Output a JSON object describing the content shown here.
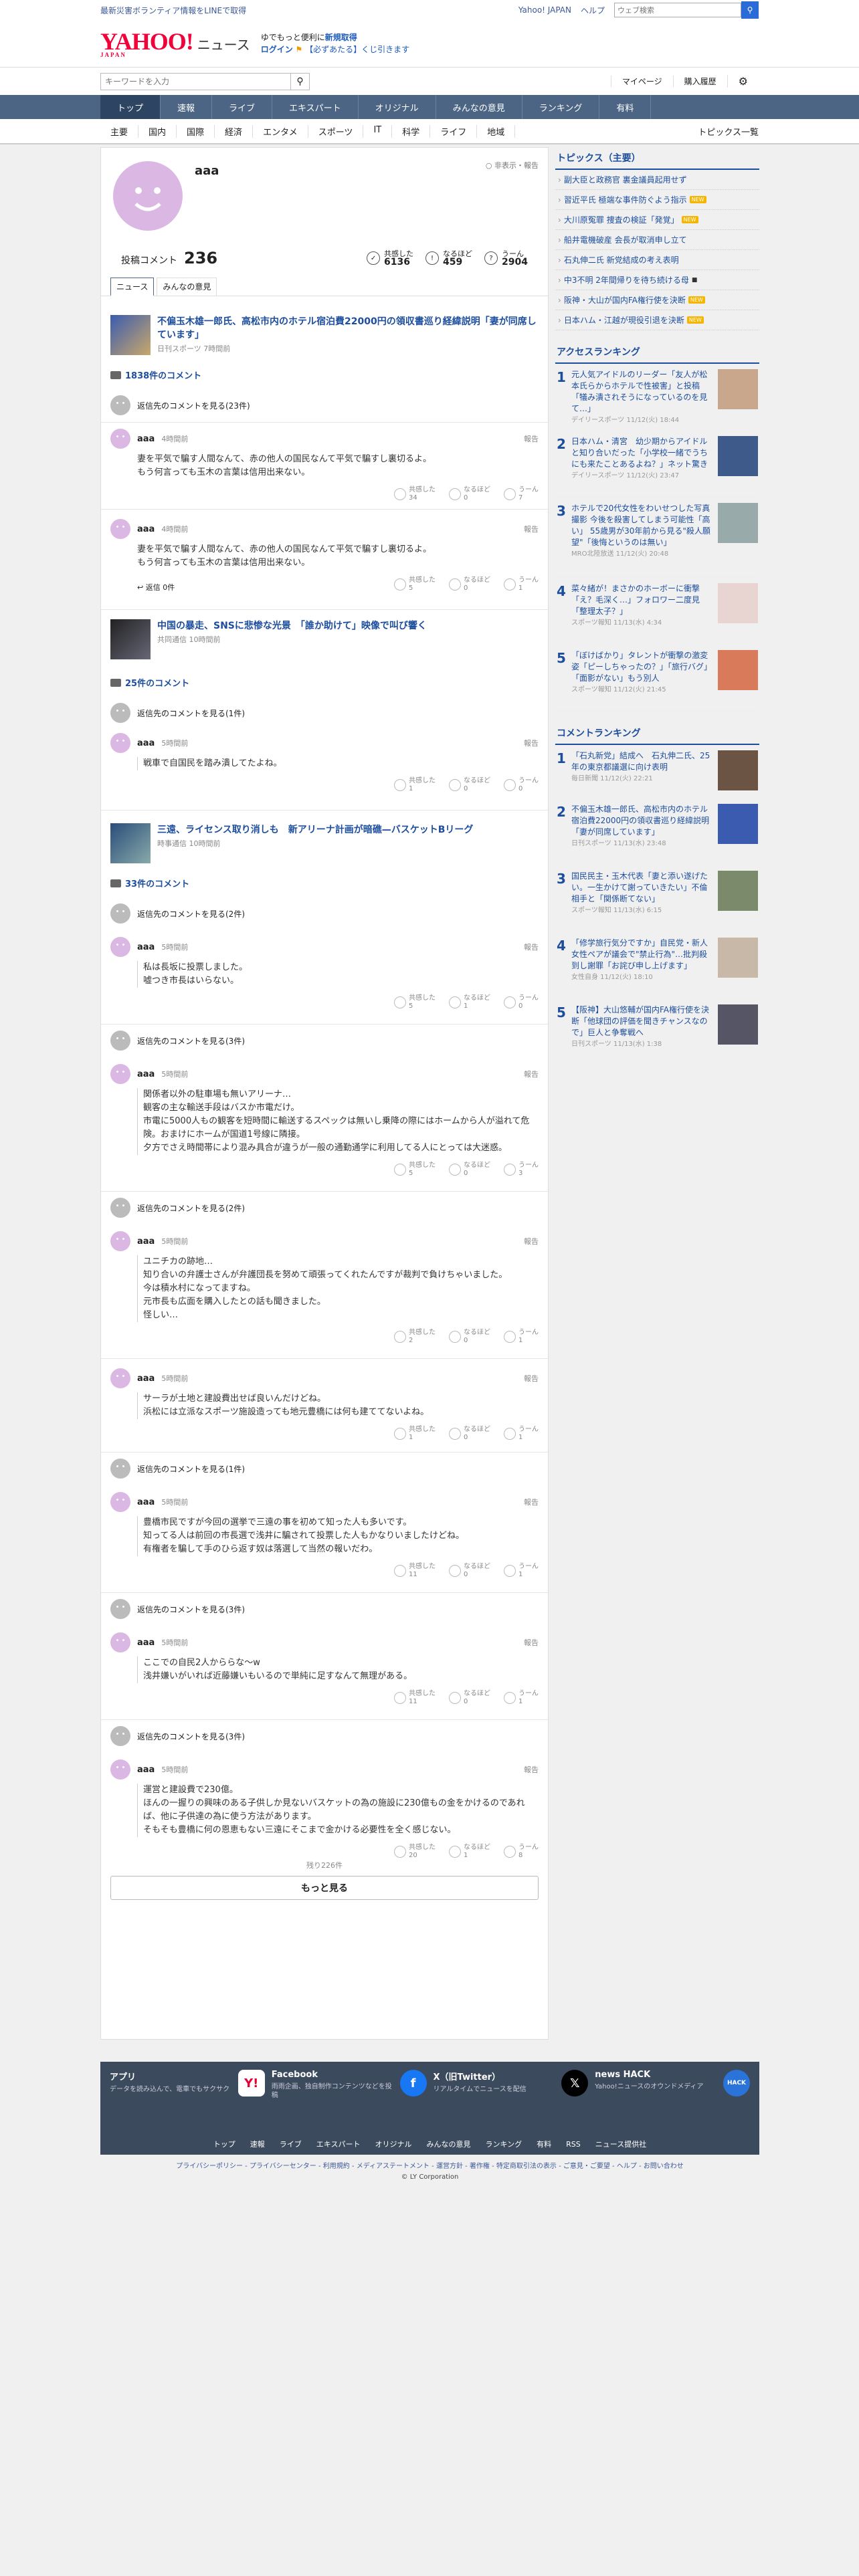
{
  "topbar": {
    "left_link": "最新災害ボランティア情報をLINEで取得",
    "links": [
      "Yahoo! JAPAN",
      "ヘルプ"
    ],
    "search_placeholder": "ウェブ検索"
  },
  "header": {
    "logo": "YAHOO!",
    "logo_sub": "JAPAN",
    "service": "ニュース",
    "promo_line1": "ゆでもっと便利に",
    "promo_link": "新規取得",
    "promo_line2a": "ログイン",
    "promo_line2b": "【必ずあたる】くじ引きます"
  },
  "searchbar": {
    "placeholder": "キーワードを入力",
    "mypage": "マイページ",
    "purchase": "購入履歴"
  },
  "gnav": [
    "トップ",
    "速報",
    "ライブ",
    "エキスパート",
    "オリジナル",
    "みんなの意見",
    "ランキング",
    "有料"
  ],
  "subnav": {
    "items": [
      "主要",
      "国内",
      "国際",
      "経済",
      "エンタメ",
      "スポーツ",
      "IT",
      "科学",
      "ライフ",
      "地域"
    ],
    "right": "トピックス一覧"
  },
  "profile": {
    "name": "aaa",
    "hide_label": "非表示・報告",
    "post_label": "投稿コメント",
    "post_count": "236",
    "reactions": [
      {
        "label": "共感した",
        "value": "6136"
      },
      {
        "label": "なるほど",
        "value": "459"
      },
      {
        "label": "うーん",
        "value": "2904"
      }
    ]
  },
  "tabs": [
    "ニュース",
    "みんなの意見"
  ],
  "articles": [
    {
      "title": "不偏玉木雄一郎氏、高松市内のホテル宿泊費22000円の領収書巡り経緯説明「妻が同席しています」",
      "source": "日刊スポーツ 7時間前",
      "count": "1838件のコメント",
      "reply": "返信先のコメントを見る(23件)"
    },
    {
      "title": "中国の暴走、SNSに悲惨な光景　「誰か助けて」映像で叫び響く",
      "source": "共同通信 10時間前",
      "count": "25件のコメント",
      "reply": "返信先のコメントを見る(1件)"
    },
    {
      "title": "三遠、ライセンス取り消しも　新アリーナ計画が暗礁—バスケットBリーグ",
      "source": "時事通信 10時間前",
      "count": "33件のコメント"
    }
  ],
  "comments": [
    {
      "name": "aaa",
      "time": "4時間前",
      "report": "報告",
      "lines": [
        "妻を平気で騙す人間なんて、赤の他人の国民なんて平気で騙すし裏切るよ。",
        "もう何言っても玉木の言葉は信用出来ない。"
      ],
      "r": [
        "34",
        "0",
        "7"
      ]
    },
    {
      "name": "aaa",
      "time": "4時間前",
      "report": "報告",
      "lines": [
        "妻を平気で騙す人間なんて、赤の他人の国民なんて平気で騙すし裏切るよ。",
        "もう何言っても玉木の言葉は信用出来ない。"
      ],
      "r": [
        "5",
        "0",
        "1"
      ],
      "reply_zero": "返信 0件"
    },
    {
      "name": "aaa",
      "time": "5時間前",
      "report": "報告",
      "lines": [
        "戦車で自国民を踏み潰してたよね。"
      ],
      "r": [
        "1",
        "0",
        "0"
      ]
    },
    {
      "name": "aaa",
      "time": "5時間前",
      "report": "報告",
      "lines": [
        "私は長坂に投票しました。",
        "嘘つき市長はいらない。"
      ],
      "r": [
        "5",
        "1",
        "0"
      ]
    },
    {
      "name": "aaa",
      "time": "5時間前",
      "report": "報告",
      "lines": [
        "関係者以外の駐車場も無いアリーナ…",
        "観客の主な輸送手段はバスか市電だけ。",
        "市電に5000人もの観客を短時間に輸送するスペックは無いし乗降の際にはホームから人が溢れて危険。おまけにホームが国道1号線に隣接。",
        "夕方でさえ時間帯により混み具合が違うが一般の通勤通学に利用してる人にとっては大迷惑。"
      ],
      "r": [
        "5",
        "0",
        "3"
      ]
    },
    {
      "name": "aaa",
      "time": "5時間前",
      "report": "報告",
      "lines": [
        "ユニチカの跡地…",
        "知り合いの弁護士さんが弁護団長を努めて頑張ってくれたんですが裁判で負けちゃいました。",
        "今は積水村になってますね。",
        "元市長も広面を購入したとの話も聞きました。",
        "怪しい…"
      ],
      "r": [
        "2",
        "0",
        "1"
      ]
    },
    {
      "name": "aaa",
      "time": "5時間前",
      "report": "報告",
      "lines": [
        "サーラが土地と建設費出せば良いんだけどね。",
        "浜松には立派なスポーツ施設造っても地元豊橋には何も建ててないよね。"
      ],
      "r": [
        "1",
        "0",
        "1"
      ]
    },
    {
      "name": "aaa",
      "time": "5時間前",
      "report": "報告",
      "lines": [
        "豊橋市民ですが今回の選挙で三遠の事を初めて知った人も多いです。",
        "知ってる人は前回の市長選で浅井に騙されて投票した人もかなりいましたけどね。",
        "有権者を騙して手のひら返す奴は落選して当然の報いだわ。"
      ],
      "r": [
        "11",
        "0",
        "1"
      ]
    },
    {
      "name": "aaa",
      "time": "5時間前",
      "report": "報告",
      "lines": [
        "ここでの自民2人かららな〜w",
        "浅井嫌いがいれば近藤嫌いもいるので単純に足すなんて無理がある。"
      ],
      "r": [
        "11",
        "0",
        "1"
      ]
    },
    {
      "name": "aaa",
      "time": "5時間前",
      "report": "報告",
      "lines": [
        "運営と建設費で230億。",
        "ほんの一握りの興味のある子供しか見ないバスケットの為の施設に230億もの金をかけるのであれば、他に子供達の為に使う方法があります。",
        "そもそも豊橋に何の恩恵もない三遠にそこまで金かける必要性を全く感じない。"
      ],
      "r": [
        "20",
        "1",
        "8"
      ]
    }
  ],
  "reply_links": [
    "返信先のコメントを見る(2件)",
    "返信先のコメントを見る(3件)",
    "返信先のコメントを見る(2件)",
    "返信先のコメントを見る(1件)",
    "返信先のコメントを見る(3件)",
    "返信先のコメントを見る(3件)"
  ],
  "reaction_labels": [
    "共感した",
    "なるほど",
    "うーん"
  ],
  "more": {
    "remaining": "残り226件",
    "button": "もっと見る"
  },
  "topics": {
    "title": "トピックス（主要）",
    "items": [
      {
        "text": "副大臣と政務官 裏金議員起用せず",
        "badge": ""
      },
      {
        "text": "習近平氏 極端な事件防ぐよう指示",
        "badge": "NEW"
      },
      {
        "text": "大川原冤罪 捜査の検証「発覚」",
        "badge": "NEW"
      },
      {
        "text": "船井電機破産 会長が取消申し立て",
        "badge": ""
      },
      {
        "text": "石丸伸二氏 新党結成の考え表明",
        "badge": ""
      },
      {
        "text": "中3不明 2年間帰りを待ち続ける母",
        "badge": "■"
      },
      {
        "text": "阪神・大山が国内FA権行使を決断",
        "badge": "NEW"
      },
      {
        "text": "日本ハム・江越が現役引退を決断",
        "badge": "NEW"
      }
    ]
  },
  "access_ranking": {
    "title": "アクセスランキング",
    "items": [
      {
        "n": "1",
        "text": "元人気アイドルのリーダー「友人が松本氏らからホテルで性被害」と投稿「犠み潰されそうになっているのを見て…」",
        "src": "デイリースポーツ 11/12(火) 18:44"
      },
      {
        "n": "2",
        "text": "日本ハム・清宮　幼少期からアイドルと知り合いだった「小学校一緒でうちにも来たことあるよね？」ネット驚き",
        "src": "デイリースポーツ 11/12(火) 23:47"
      },
      {
        "n": "3",
        "text": "ホテルで20代女性をわいせつした写真撮影 今後を殺害してしまう可能性「高い」 55歳男が30年前から見る\"殺人願望\"「後悔というのは無い」",
        "src": "MRO北陸放送 11/12(火) 20:48"
      },
      {
        "n": "4",
        "text": "菜々緒が！まさかのホーボーに衝撃「え？毛深く…」フォロワー二度見「整理太子？」",
        "src": "スポーツ報知 11/13(水) 4:34"
      },
      {
        "n": "5",
        "text": "「ぼけばかり」タレントが衝撃の激変姿「ピーしちゃったの？」「旅行バグ」「面影がない」もう別人",
        "src": "スポーツ報知 11/12(火) 21:45"
      }
    ]
  },
  "comment_ranking": {
    "title": "コメントランキング",
    "items": [
      {
        "n": "1",
        "text": "「石丸新党」結成へ　石丸伸二氏、25年の東京都議選に向け表明",
        "src": "毎日新聞 11/12(火) 22:21"
      },
      {
        "n": "2",
        "text": "不偏玉木雄一郎氏、高松市内のホテル宿泊費22000円の領収書巡り経緯説明「妻が同席しています」",
        "src": "日刊スポーツ 11/13(水) 23:48"
      },
      {
        "n": "3",
        "text": "国民民主・玉木代表「妻と添い遂げたい。一生かけて謝っていきたい」不倫相手と「関係断てない」",
        "src": "スポーツ報知 11/13(水) 6:15"
      },
      {
        "n": "4",
        "text": "「修学旅行気分ですか」自民党・新人女性ペアが議会で\"禁止行為\"…批判殺到し謝罪「お詫び申し上げます」",
        "src": "女性自身 11/12(火) 18:10"
      },
      {
        "n": "5",
        "text": "【阪神】大山悠輔が国内FA権行使を決断「他球団の評価を聞きチャンスなので」巨人と争奪戦へ",
        "src": "日刊スポーツ 11/13(水) 1:38"
      }
    ]
  },
  "footer": {
    "cols": [
      {
        "title": "アプリ",
        "desc": "データを読み込んで、電車でもサクサク"
      },
      {
        "title": "Facebook",
        "desc": "雨雨企画、独自制作コンテンツなどを投稿"
      },
      {
        "title": "X（旧Twitter）",
        "desc": "リアルタイムでニュースを配信"
      },
      {
        "title": "news HACK",
        "desc": "Yahoo!ニュースのオウンドメディア"
      }
    ],
    "links": [
      "トップ",
      "速報",
      "ライブ",
      "エキスパート",
      "オリジナル",
      "みんなの意見",
      "ランキング",
      "有料",
      "RSS",
      "ニュース提供社"
    ],
    "legal": "プライバシーポリシー - プライバシーセンター - 利用規約 - メディアステートメント - 運営方針 - 著作権 - 特定商取引法の表示 - ご意見・ご要望 - ヘルプ - お問い合わせ",
    "copyright": "© LY Corporation"
  },
  "colors": {
    "nav": "#4d6584",
    "link": "#1d4e9e",
    "logo": "#f0033a",
    "avatar": "#dbb8e3"
  }
}
